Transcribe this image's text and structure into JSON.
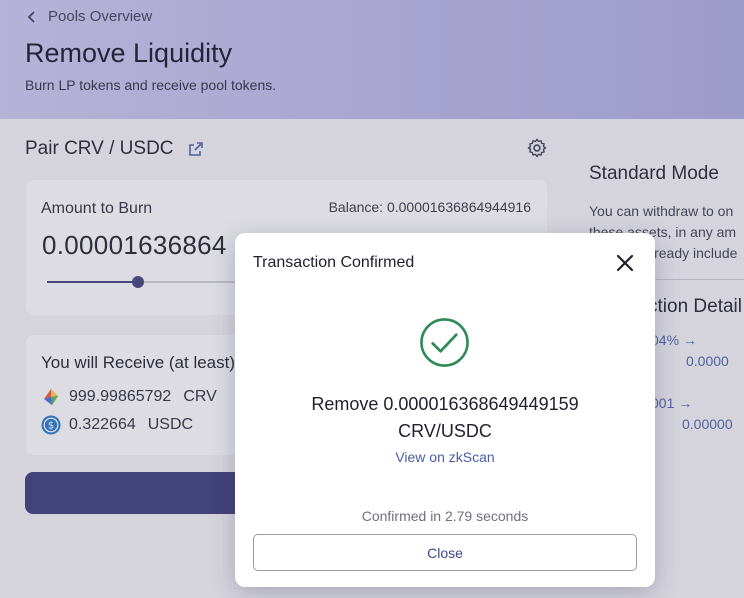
{
  "header": {
    "back_label": "Pools Overview",
    "title": "Remove Liquidity",
    "subtitle": "Burn LP tokens and receive pool tokens."
  },
  "pair": {
    "title": "Pair CRV / USDC"
  },
  "amount": {
    "label": "Amount to Burn",
    "balance": "Balance: 0.00001636864944916",
    "value": "0.00001636864",
    "slider_fraction": 0.19
  },
  "receive": {
    "label": "You will Receive (at least)",
    "tokens": [
      {
        "amount": "999.99865792",
        "symbol": "CRV",
        "icon": "crv-token-icon"
      },
      {
        "amount": "0.322664",
        "symbol": "USDC",
        "icon": "usdc-token-icon"
      }
    ]
  },
  "side_panel": {
    "title": "Standard Mode",
    "line1": "You can withdraw to on",
    "line2": "these assets, in any am",
    "line3": "lready include",
    "heading": "ction Detail",
    "row1_label": "04% →",
    "row1_value": "0.0000",
    "row2_label": "001 →",
    "row2_value": "0.00000"
  },
  "modal": {
    "title": "Transaction Confirmed",
    "message_line1": "Remove 0.000016368649449159",
    "message_line2": "CRV/USDC",
    "link": "View on zkScan",
    "confirm_time": "Confirmed in 2.79 seconds",
    "close_label": "Close"
  },
  "colors": {
    "accent": "#3a3a7c",
    "success": "#2e8b57",
    "link": "#4a5ea8"
  }
}
